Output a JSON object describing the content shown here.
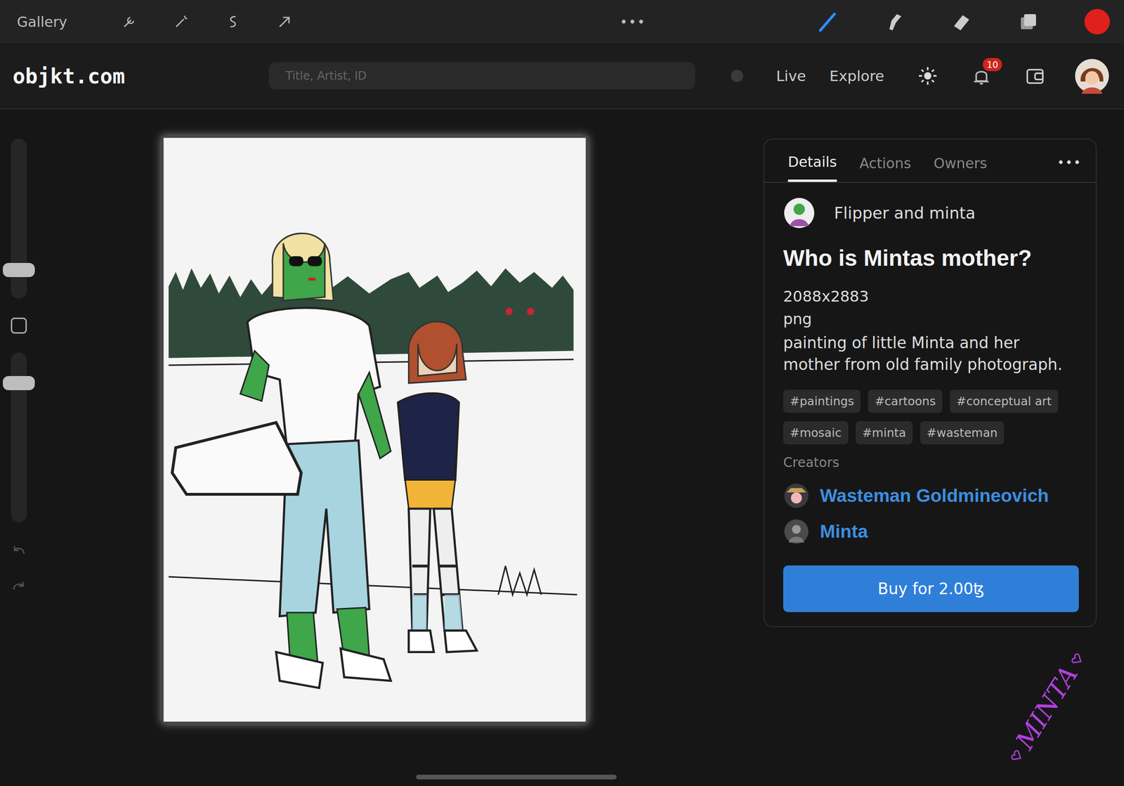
{
  "toolbar": {
    "gallery": "Gallery",
    "more": "•••",
    "tools": [
      {
        "kind": "brush",
        "selected": true
      },
      {
        "kind": "smudge",
        "selected": false
      },
      {
        "kind": "eraser",
        "selected": false
      },
      {
        "kind": "layers",
        "selected": false
      }
    ],
    "current_color": "#e0201a"
  },
  "header": {
    "logo": "objkt.com",
    "search": {
      "placeholder": "Title, Artist, ID"
    },
    "nav": [
      "Live",
      "Explore"
    ],
    "notifications": "10"
  },
  "sidebar": {
    "sliders": [
      {
        "level": 0.15
      },
      {
        "level": 0.85
      }
    ]
  },
  "panel": {
    "tabs": [
      {
        "label": "Details",
        "selected": true
      },
      {
        "label": "Actions",
        "selected": false
      },
      {
        "label": "Owners",
        "selected": false
      }
    ],
    "more": "•••",
    "artist": "Flipper and minta",
    "title": "Who is Mintas mother?",
    "dimensions": "2088x2883",
    "format": "png",
    "description": "painting of little Minta and her mother from old family photograph.",
    "tags": [
      "#paintings",
      "#cartoons",
      "#conceptual art",
      "#mosaic",
      "#minta",
      "#wasteman"
    ],
    "creators_label": "Creators",
    "creators": [
      "Wasteman Goldmineovich",
      "Minta"
    ],
    "buy": "Buy for 2.00ꜩ"
  },
  "signature": "MINTA"
}
